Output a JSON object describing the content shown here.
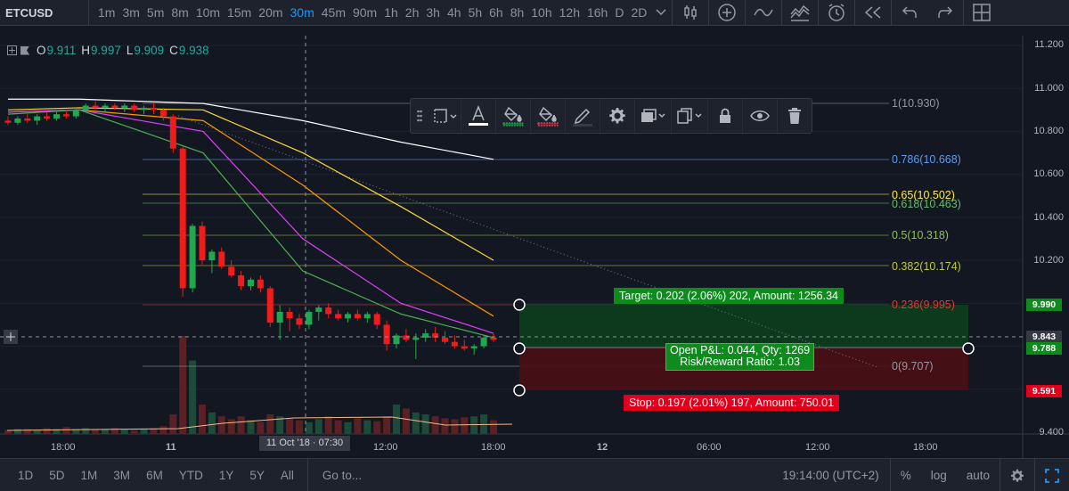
{
  "toolbar": {
    "symbol": "ETCUSD",
    "intervals": [
      "1m",
      "3m",
      "5m",
      "8m",
      "10m",
      "15m",
      "20m",
      "30m",
      "45m",
      "90m",
      "1h",
      "2h",
      "3h",
      "4h",
      "5h",
      "6h",
      "8h",
      "10h",
      "12h",
      "16h",
      "D",
      "2D"
    ],
    "active_interval": "30m",
    "icons": [
      "chevron-down-icon",
      "candles-icon",
      "indicator-add-icon",
      "compare-line-icon",
      "templates-icon",
      "alert-icon",
      "replay-icon",
      "undo-icon",
      "redo-icon",
      "layout-grid-icon"
    ]
  },
  "legend": {
    "open_key": "O",
    "open": "9.911",
    "high_key": "H",
    "high": "9.997",
    "low_key": "L",
    "low": "9.909",
    "close_key": "C",
    "close": "9.938"
  },
  "drawing_toolbar": {
    "icons": [
      "drag-handle-icon",
      "line-style-icon",
      "text-color-icon",
      "fill-green-icon",
      "fill-red-icon",
      "pencil-icon",
      "gear-icon",
      "visual-order-icon",
      "clone-icon",
      "lock-icon",
      "eye-icon",
      "trash-icon"
    ]
  },
  "price_axis": {
    "labels": [
      "11.200",
      "11.000",
      "10.800",
      "10.600",
      "10.400",
      "10.200",
      "9.400"
    ],
    "tags": [
      {
        "text": "9.990",
        "color": "#0f8a1c"
      },
      {
        "text": "9.843",
        "color": "#363a45"
      },
      {
        "text": "9.788",
        "color": "#0f8a1c"
      },
      {
        "text": "9.591",
        "color": "#e0001b"
      }
    ]
  },
  "fib_levels": [
    {
      "label": "1(10.930)",
      "color": "#9598a1"
    },
    {
      "label": "0.786(10.668)",
      "color": "#5b9cf6"
    },
    {
      "label": "0.65(10.502)",
      "color": "#ffeb3b"
    },
    {
      "label": "0.618(10.463)",
      "color": "#66bb6a"
    },
    {
      "label": "0.5(10.318)",
      "color": "#8bc34a"
    },
    {
      "label": "0.382(10.174)",
      "color": "#c0ca33"
    },
    {
      "label": "0.236(9.995)",
      "color": "#e53935"
    },
    {
      "label": "0(9.707)",
      "color": "#9598a1"
    }
  ],
  "position": {
    "target": "Target: 0.202 (2.06%) 202, Amount: 1256.34",
    "open_line1": "Open P&L: 0.044, Qty: 1269",
    "open_line2": "Risk/Reward Ratio: 1.03",
    "stop": "Stop: 0.197 (2.01%) 197, Amount: 750.01"
  },
  "time_axis": {
    "labels": [
      "18:00",
      "11",
      "12:00",
      "18:00",
      "12",
      "06:00",
      "12:00",
      "18:00"
    ],
    "crosshair": "11 Oct '18 · 07:30"
  },
  "bottom": {
    "ranges": [
      "1D",
      "5D",
      "1M",
      "3M",
      "6M",
      "YTD",
      "1Y",
      "5Y",
      "All"
    ],
    "goto": "Go to...",
    "clock": "19:14:00 (UTC+2)",
    "percent": "%",
    "log": "log",
    "auto": "auto"
  },
  "colors": {
    "up": "#26a69a",
    "up_candle": "#1fa84e",
    "down": "#ef1c1c",
    "accent": "#2196f3",
    "target_zone": "#0d3d1c",
    "stop_zone": "#4a0f14"
  },
  "chart_data": {
    "type": "candlestick",
    "symbol": "ETCUSD",
    "interval": "30m",
    "ylim": [
      9.4,
      11.2
    ],
    "x": [
      "10 18:00",
      "11",
      "11 12:00",
      "11 18:00",
      "12",
      "12 06:00",
      "12 12:00",
      "12 18:00"
    ],
    "candles": [
      {
        "o": 10.85,
        "h": 10.87,
        "l": 10.83,
        "c": 10.84
      },
      {
        "o": 10.84,
        "h": 10.87,
        "l": 10.83,
        "c": 10.86
      },
      {
        "o": 10.86,
        "h": 10.88,
        "l": 10.84,
        "c": 10.85
      },
      {
        "o": 10.85,
        "h": 10.88,
        "l": 10.83,
        "c": 10.87
      },
      {
        "o": 10.87,
        "h": 10.89,
        "l": 10.85,
        "c": 10.86
      },
      {
        "o": 10.86,
        "h": 10.89,
        "l": 10.85,
        "c": 10.88
      },
      {
        "o": 10.88,
        "h": 10.9,
        "l": 10.86,
        "c": 10.87
      },
      {
        "o": 10.87,
        "h": 10.91,
        "l": 10.86,
        "c": 10.9
      },
      {
        "o": 10.9,
        "h": 10.93,
        "l": 10.89,
        "c": 10.92
      },
      {
        "o": 10.92,
        "h": 10.94,
        "l": 10.9,
        "c": 10.91
      },
      {
        "o": 10.91,
        "h": 10.93,
        "l": 10.89,
        "c": 10.92
      },
      {
        "o": 10.92,
        "h": 10.93,
        "l": 10.9,
        "c": 10.91
      },
      {
        "o": 10.91,
        "h": 10.93,
        "l": 10.89,
        "c": 10.92
      },
      {
        "o": 10.92,
        "h": 10.93,
        "l": 10.89,
        "c": 10.9
      },
      {
        "o": 10.9,
        "h": 10.92,
        "l": 10.88,
        "c": 10.91
      },
      {
        "o": 10.91,
        "h": 10.93,
        "l": 10.88,
        "c": 10.9
      },
      {
        "o": 10.9,
        "h": 10.91,
        "l": 10.85,
        "c": 10.87
      },
      {
        "o": 10.87,
        "h": 10.88,
        "l": 10.7,
        "c": 10.72
      },
      {
        "o": 10.72,
        "h": 10.73,
        "l": 10.03,
        "c": 10.07
      },
      {
        "o": 10.07,
        "h": 10.37,
        "l": 10.05,
        "c": 10.36
      },
      {
        "o": 10.36,
        "h": 10.38,
        "l": 10.18,
        "c": 10.2
      },
      {
        "o": 10.2,
        "h": 10.25,
        "l": 10.14,
        "c": 10.24
      },
      {
        "o": 10.24,
        "h": 10.26,
        "l": 10.16,
        "c": 10.17
      },
      {
        "o": 10.17,
        "h": 10.2,
        "l": 10.12,
        "c": 10.13
      },
      {
        "o": 10.13,
        "h": 10.15,
        "l": 10.06,
        "c": 10.08
      },
      {
        "o": 10.08,
        "h": 10.12,
        "l": 10.06,
        "c": 10.11
      },
      {
        "o": 10.11,
        "h": 10.13,
        "l": 10.05,
        "c": 10.07
      },
      {
        "o": 10.07,
        "h": 10.08,
        "l": 9.89,
        "c": 9.91
      },
      {
        "o": 9.91,
        "h": 9.99,
        "l": 9.83,
        "c": 9.96
      },
      {
        "o": 9.96,
        "h": 9.98,
        "l": 9.87,
        "c": 9.93
      },
      {
        "o": 9.93,
        "h": 9.95,
        "l": 9.88,
        "c": 9.9
      },
      {
        "o": 9.9,
        "h": 9.97,
        "l": 9.88,
        "c": 9.96
      },
      {
        "o": 9.96,
        "h": 9.99,
        "l": 9.92,
        "c": 9.98
      },
      {
        "o": 9.98,
        "h": 10.0,
        "l": 9.93,
        "c": 9.95
      },
      {
        "o": 9.95,
        "h": 9.97,
        "l": 9.92,
        "c": 9.93
      },
      {
        "o": 9.93,
        "h": 9.96,
        "l": 9.91,
        "c": 9.95
      },
      {
        "o": 9.95,
        "h": 9.97,
        "l": 9.92,
        "c": 9.93
      },
      {
        "o": 9.93,
        "h": 9.96,
        "l": 9.91,
        "c": 9.95
      },
      {
        "o": 9.95,
        "h": 9.96,
        "l": 9.88,
        "c": 9.9
      },
      {
        "o": 9.9,
        "h": 9.92,
        "l": 9.78,
        "c": 9.81
      },
      {
        "o": 9.81,
        "h": 9.86,
        "l": 9.79,
        "c": 9.85
      },
      {
        "o": 9.85,
        "h": 9.88,
        "l": 9.82,
        "c": 9.83
      },
      {
        "o": 9.83,
        "h": 9.86,
        "l": 9.74,
        "c": 9.84
      },
      {
        "o": 9.84,
        "h": 9.88,
        "l": 9.82,
        "c": 9.86
      },
      {
        "o": 9.86,
        "h": 9.89,
        "l": 9.82,
        "c": 9.84
      },
      {
        "o": 9.84,
        "h": 9.87,
        "l": 9.81,
        "c": 9.82
      },
      {
        "o": 9.82,
        "h": 9.85,
        "l": 9.79,
        "c": 9.8
      },
      {
        "o": 9.8,
        "h": 9.83,
        "l": 9.78,
        "c": 9.79
      },
      {
        "o": 9.79,
        "h": 9.81,
        "l": 9.76,
        "c": 9.8
      },
      {
        "o": 9.8,
        "h": 9.85,
        "l": 9.79,
        "c": 9.84
      },
      {
        "o": 9.84,
        "h": 9.86,
        "l": 9.82,
        "c": 9.83
      }
    ],
    "moving_averages": [
      {
        "color": "#ffffff",
        "values": [
          10.95,
          10.95,
          10.93,
          10.85,
          10.75,
          10.67
        ]
      },
      {
        "color": "#fdd835",
        "values": [
          10.9,
          10.91,
          10.9,
          10.7,
          10.45,
          10.2
        ]
      },
      {
        "color": "#ff9800",
        "values": [
          10.89,
          10.9,
          10.85,
          10.55,
          10.2,
          9.94
        ]
      },
      {
        "color": "#e040fb",
        "values": [
          10.89,
          10.9,
          10.8,
          10.3,
          10.0,
          9.86
        ]
      },
      {
        "color": "#4caf50",
        "values": [
          10.88,
          10.9,
          10.7,
          10.15,
          9.95,
          9.84
        ]
      }
    ]
  }
}
